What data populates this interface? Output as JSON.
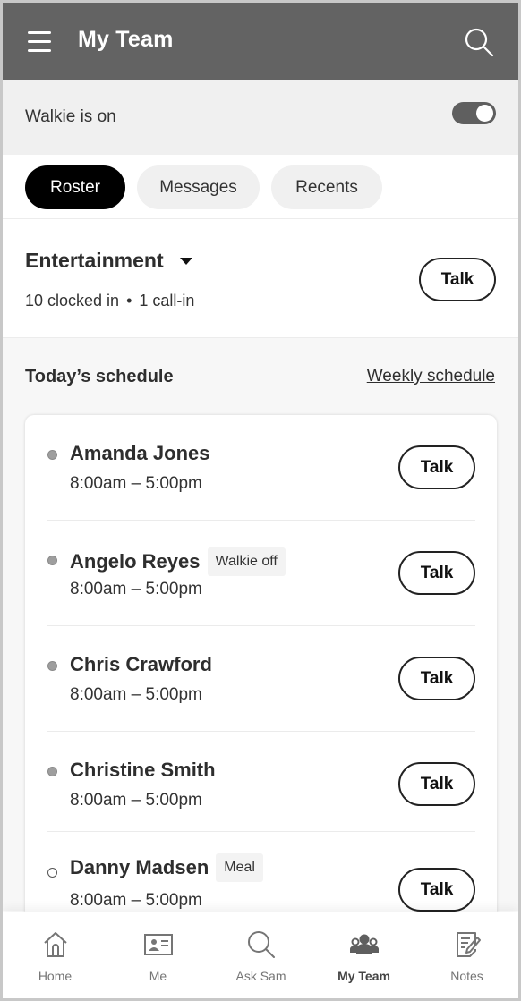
{
  "header": {
    "title": "My Team",
    "menu_icon": "hamburger-menu-icon",
    "search_icon": "search-icon"
  },
  "walkie": {
    "label": "Walkie is on",
    "enabled": true
  },
  "tabs": [
    {
      "label": "Roster",
      "active": true
    },
    {
      "label": "Messages",
      "active": false
    },
    {
      "label": "Recents",
      "active": false
    }
  ],
  "team": {
    "name": "Entertainment",
    "clocked_in": "10 clocked in",
    "separator": "•",
    "call_in": "1 call-in",
    "talk_label": "Talk"
  },
  "schedule": {
    "title": "Today’s schedule",
    "weekly_link": "Weekly schedule",
    "employees": [
      {
        "name": "Amanda Jones",
        "time": "8:00am – 5:00pm",
        "status": "on",
        "badge": null,
        "talk_label": "Talk"
      },
      {
        "name": "Angelo Reyes",
        "time": "8:00am – 5:00pm",
        "status": "on",
        "badge": "Walkie off",
        "talk_label": "Talk"
      },
      {
        "name": "Chris Crawford",
        "time": "8:00am – 5:00pm",
        "status": "on",
        "badge": null,
        "talk_label": "Talk"
      },
      {
        "name": "Christine Smith",
        "time": "8:00am – 5:00pm",
        "status": "on",
        "badge": null,
        "talk_label": "Talk"
      },
      {
        "name": "Danny Madsen",
        "time": "8:00am – 5:00pm",
        "status": "off",
        "badge": "Meal",
        "talk_label": "Talk"
      }
    ]
  },
  "bottom_nav": [
    {
      "label": "Home",
      "icon": "home-icon",
      "active": false
    },
    {
      "label": "Me",
      "icon": "id-card-icon",
      "active": false
    },
    {
      "label": "Ask Sam",
      "icon": "search-icon",
      "active": false
    },
    {
      "label": "My Team",
      "icon": "team-icon",
      "active": true
    },
    {
      "label": "Notes",
      "icon": "notes-icon",
      "active": false
    }
  ],
  "colors": {
    "app_bar": "#636363",
    "walkie_bar": "#f0f0f0",
    "active_tab": "#000000",
    "inactive_tab": "#f0f0f0",
    "status_on": "#9e9e9e"
  }
}
